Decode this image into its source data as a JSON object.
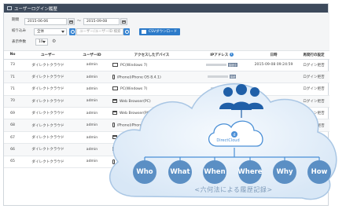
{
  "panel": {
    "title": "ユーザーログイン履歴"
  },
  "filters": {
    "period_label": "期間",
    "date_from": "2015-06-06",
    "date_tilde": "〜",
    "date_to": "2015-09-08",
    "narrow_label": "絞り込み",
    "narrow_value": "全体",
    "search_placeholder": "ユーザー/ユーザーID 検索",
    "csv_label": "CSVダウンロード",
    "per_page_label": "表示件数",
    "per_page_value": "10"
  },
  "table": {
    "headers": [
      "No",
      "ユーザー",
      "ユーザーID",
      "アクセスしたデバイス",
      "IPアドレス",
      "日時",
      "再発行の設定"
    ],
    "rows": [
      {
        "no": "73",
        "user": "ダイレクトクラウド",
        "uid": "admin",
        "icon": "pc-icon",
        "device": "PC(Windows 7)",
        "badge": "接続中",
        "date": "2015-09-08 09:24:59",
        "action": "ログイン拒否"
      },
      {
        "no": "71",
        "user": "ダイレクトクラウド",
        "uid": "admin",
        "icon": "phone-icon",
        "device": "iPhone(iPhone OS 8.4.1)",
        "badge": "接続",
        "date": "",
        "action": "ログイン拒否"
      },
      {
        "no": "71",
        "user": "ダイレクトクラウド",
        "uid": "admin",
        "icon": "pc-icon",
        "device": "PC(Windows 7)",
        "badge": "",
        "date": "",
        "action": "ログイン拒否"
      },
      {
        "no": "70",
        "user": "ダイレクトクラウド",
        "uid": "admin",
        "icon": "web-icon",
        "device": "Web Browser(PC)",
        "badge": "",
        "date": "",
        "action": "ログイン拒否"
      },
      {
        "no": "69",
        "user": "ダイレクトクラウド",
        "uid": "admin",
        "icon": "web-icon",
        "device": "Web Browser(PC)",
        "badge": "",
        "date": "",
        "action": "ログイン拒否"
      },
      {
        "no": "68",
        "user": "ダイレクトクラウド",
        "uid": "admin",
        "icon": "phone-icon",
        "device": "iPhone(iPhone OS 8.4.1)",
        "badge": "",
        "date": "",
        "action": "ログイン拒否"
      },
      {
        "no": "67",
        "user": "ダイレクトクラウド",
        "uid": "admin",
        "icon": "web-icon",
        "device": "Web Browser(PC)",
        "badge": "",
        "date": "",
        "action": "ログイン拒否"
      },
      {
        "no": "66",
        "user": "ダイレクトクラウド",
        "uid": "admin",
        "icon": "web-icon",
        "device": "Web Browser(PC)",
        "badge": "",
        "date": "",
        "action": "ログイン拒否"
      },
      {
        "no": "65",
        "user": "ダイレクトクラウド",
        "uid": "admin",
        "icon": "phone-icon",
        "device": "iPhone(iPh",
        "badge": "",
        "date": "",
        "action": "ログイン拒否"
      }
    ]
  },
  "overlay": {
    "logo": "DirectCloud",
    "words": [
      "Who",
      "What",
      "When",
      "Where",
      "Why",
      "How"
    ],
    "caption": "<六何法による履歴記録>"
  },
  "colors": {
    "header_bar": "#3d4a5c",
    "accent_blue": "#3a86d2",
    "circle_blue": "#5b8fc4",
    "cloud_fill": "#e4eef8",
    "action_red": "#c0392b"
  }
}
